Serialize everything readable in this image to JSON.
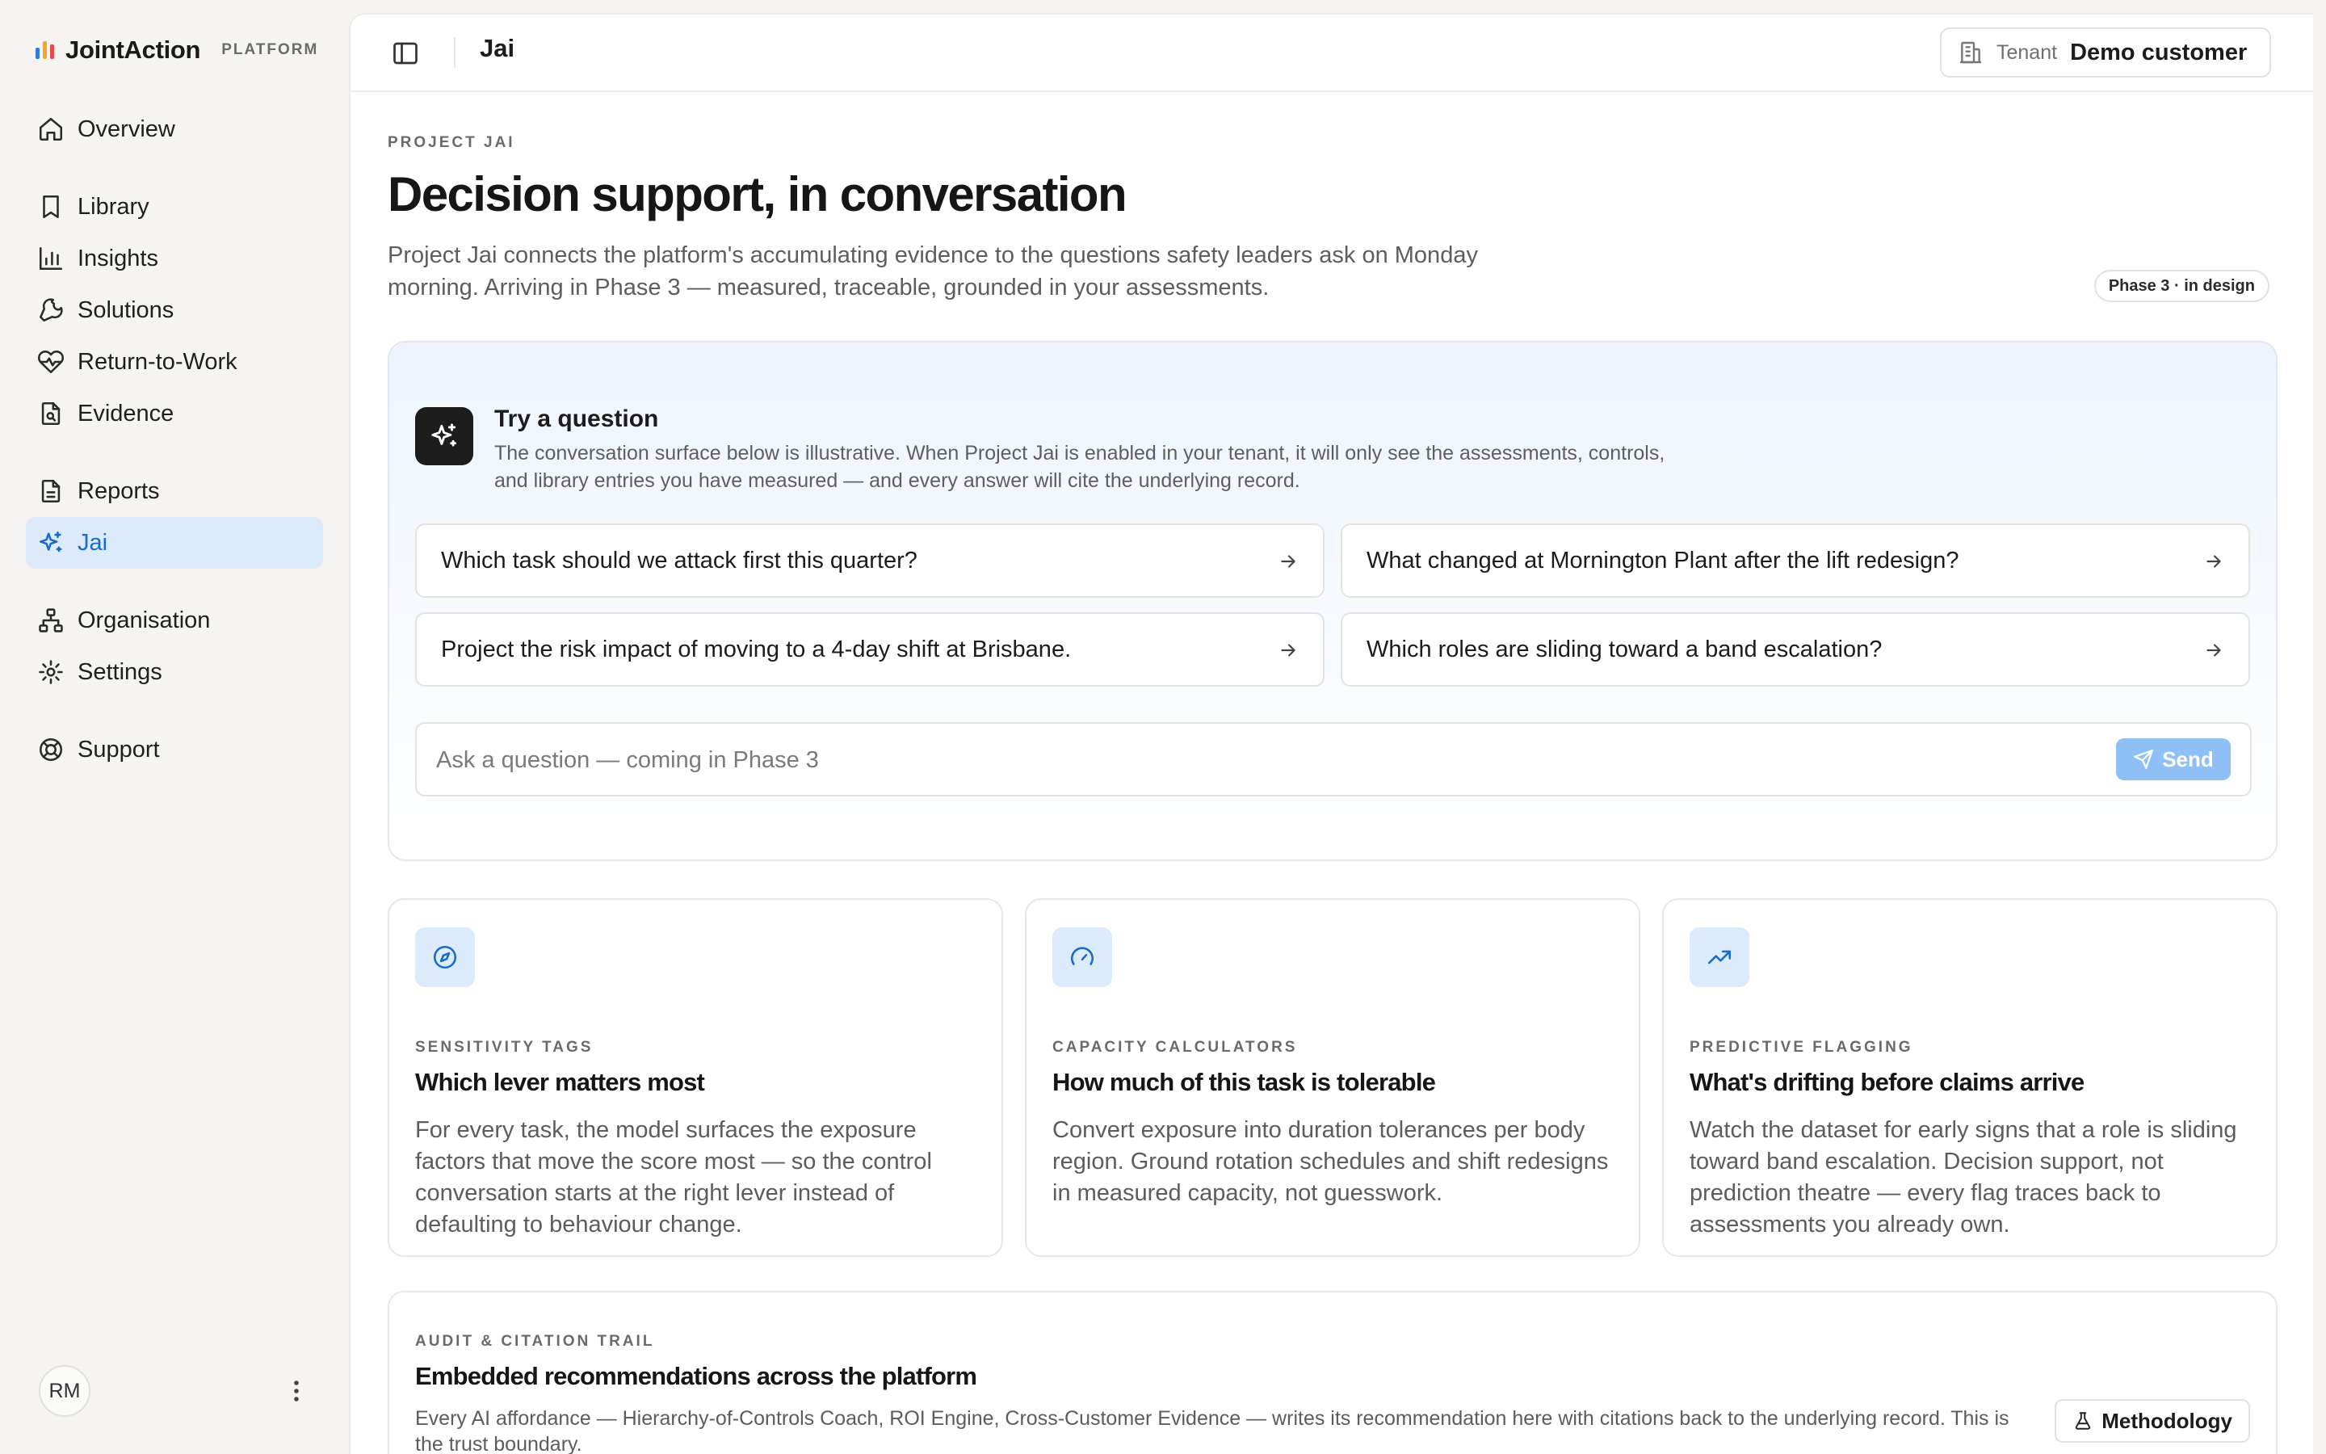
{
  "brand": {
    "name": "JointAction",
    "tag": "PLATFORM",
    "bar_colors": [
      "#2f7ae5",
      "#f2a623",
      "#e5484d"
    ]
  },
  "sidebar": {
    "items": [
      {
        "label": "Overview",
        "icon": "home-icon"
      },
      {
        "label": "Library",
        "icon": "bookmark-icon"
      },
      {
        "label": "Insights",
        "icon": "bar-chart-icon"
      },
      {
        "label": "Solutions",
        "icon": "wrench-icon"
      },
      {
        "label": "Return-to-Work",
        "icon": "heart-pulse-icon"
      },
      {
        "label": "Evidence",
        "icon": "file-search-icon"
      },
      {
        "label": "Reports",
        "icon": "document-icon"
      },
      {
        "label": "Jai",
        "icon": "sparkles-icon",
        "active": true
      },
      {
        "label": "Organisation",
        "icon": "org-chart-icon"
      },
      {
        "label": "Settings",
        "icon": "gear-icon"
      },
      {
        "label": "Support",
        "icon": "lifebuoy-icon"
      }
    ],
    "user_initials": "RM"
  },
  "topbar": {
    "title": "Jai",
    "tenant_label": "Tenant",
    "tenant_value": "Demo customer"
  },
  "page": {
    "eyebrow": "PROJECT JAI",
    "title": "Decision support, in conversation",
    "description": "Project Jai connects the platform's accumulating evidence to the questions safety leaders ask on Monday morning. Arriving in Phase 3 — measured, traceable, grounded in your assessments.",
    "phase_badge": "Phase 3 · in design"
  },
  "try": {
    "title": "Try a question",
    "description": "The conversation surface below is illustrative. When Project Jai is enabled in your tenant, it will only see the assessments, controls, and library entries you have measured — and every answer will cite the underlying record.",
    "questions": [
      "Which task should we attack first this quarter?",
      "What changed at Mornington Plant after the lift redesign?",
      "Project the risk impact of moving to a 4-day shift at Brisbane.",
      "Which roles are sliding toward a band escalation?"
    ],
    "ask_placeholder": "Ask a question — coming in Phase 3",
    "send_label": "Send"
  },
  "features": [
    {
      "icon": "compass-icon",
      "eyebrow": "SENSITIVITY TAGS",
      "title": "Which lever matters most",
      "description": "For every task, the model surfaces the exposure factors that move the score most — so the control conversation starts at the right lever instead of defaulting to behaviour change."
    },
    {
      "icon": "gauge-icon",
      "eyebrow": "CAPACITY CALCULATORS",
      "title": "How much of this task is tolerable",
      "description": "Convert exposure into duration tolerances per body region. Ground rotation schedules and shift redesigns in measured capacity, not guesswork."
    },
    {
      "icon": "trending-up-icon",
      "eyebrow": "PREDICTIVE FLAGGING",
      "title": "What's drifting before claims arrive",
      "description": "Watch the dataset for early signs that a role is sliding toward band escalation. Decision support, not prediction theatre — every flag traces back to assessments you already own."
    }
  ],
  "audit": {
    "eyebrow": "AUDIT & CITATION TRAIL",
    "title": "Embedded recommendations across the platform",
    "description": "Every AI affordance — Hierarchy-of-Controls Coach, ROI Engine, Cross-Customer Evidence — writes its recommendation here with citations back to the underlying record. This is the trust boundary.",
    "method_label": "Methodology",
    "method_icon": "flask-icon"
  },
  "colors": {
    "accent": "#1b69c9",
    "accent_bg": "#dcebfb",
    "send_bg": "#8fc0f5"
  }
}
